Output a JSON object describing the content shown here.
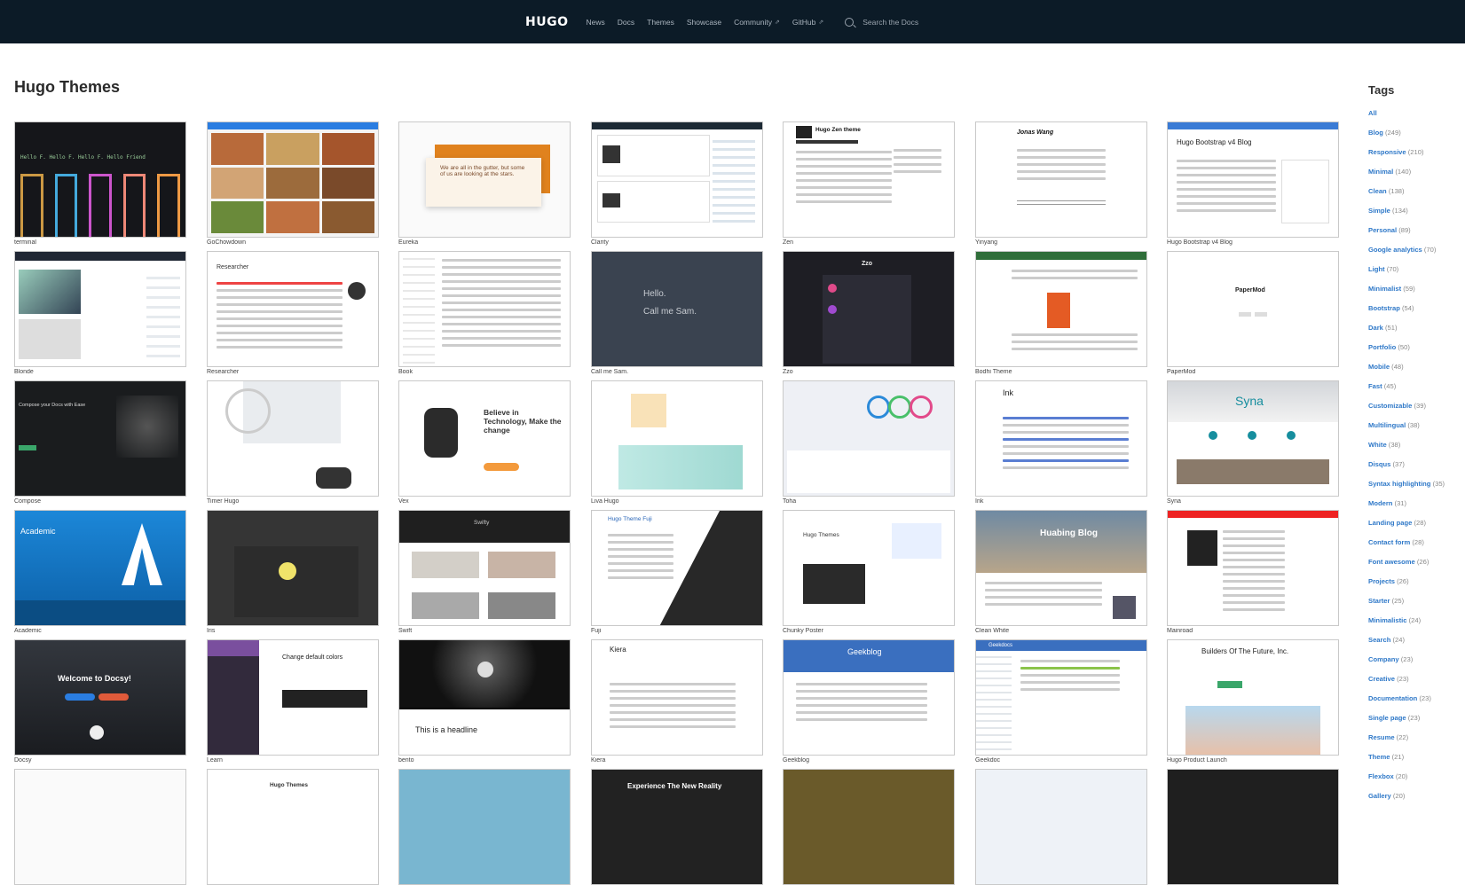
{
  "nav": {
    "logo": "HUGO",
    "links": [
      "News",
      "Docs",
      "Themes",
      "Showcase",
      "Community",
      "GitHub"
    ],
    "search_placeholder": "Search the Docs"
  },
  "page_title": "Hugo Themes",
  "themes": [
    "terminal",
    "GoChowdown",
    "Eureka",
    "Clarity",
    "Zen",
    "Yinyang",
    "Hugo Bootstrap v4 Blog",
    "Blonde",
    "Researcher",
    "Book",
    "Call me Sam.",
    "Zzo",
    "Bodhi Theme",
    "PaperMod",
    "Compose",
    "Timer Hugo",
    "Vex",
    "Liva Hugo",
    "Toha",
    "Ink",
    "Syna",
    "Academic",
    "Iris",
    "Swift",
    "Fuji",
    "Chunky Poster",
    "Clean White",
    "Mainroad",
    "Docsy",
    "Learn",
    "bento",
    "Kiera",
    "Geekblog",
    "Geekdoc",
    "Hugo Product Launch",
    "",
    "",
    "",
    "",
    "",
    "",
    ""
  ],
  "thumb_text": {
    "eureka": "We are all in the gutter, but some of us are looking at the stars.",
    "callme_1": "Hello.",
    "callme_2": "Call me Sam.",
    "bootstrap": "Hugo Bootstrap v4 Blog",
    "zen": "Hugo Zen theme",
    "yinyang": "Jonas Wang",
    "researcher": "Researcher",
    "vex": "Believe in Technology, Make the change",
    "ink": "Ink",
    "syna": "Syna",
    "academic": "Academic",
    "swift": "Swifty",
    "fuji": "Hugo Theme Fuji",
    "chunky": "Hugo Themes",
    "cleanwhite": "Huabing Blog",
    "docsy": "Welcome to Docsy!",
    "learn": "Change default colors",
    "bento": "This is a headline",
    "kiera": "Kiera",
    "geekblog": "Geekblog",
    "geekdoc": "Geekdocs",
    "launch": "Builders Of The Future, Inc.",
    "papermod": "PaperMod",
    "zzo": "Zzo",
    "compose": "Compose your Docs with Ease",
    "reality": "Experience The New Reality",
    "rowsix_chunky": "Hugo Themes"
  },
  "tags_title": "Tags",
  "tags": [
    {
      "name": "All",
      "count": ""
    },
    {
      "name": "Blog",
      "count": "(249)"
    },
    {
      "name": "Responsive",
      "count": "(210)"
    },
    {
      "name": "Minimal",
      "count": "(140)"
    },
    {
      "name": "Clean",
      "count": "(138)"
    },
    {
      "name": "Simple",
      "count": "(134)"
    },
    {
      "name": "Personal",
      "count": "(89)"
    },
    {
      "name": "Google analytics",
      "count": "(70)"
    },
    {
      "name": "Light",
      "count": "(70)"
    },
    {
      "name": "Minimalist",
      "count": "(59)"
    },
    {
      "name": "Bootstrap",
      "count": "(54)"
    },
    {
      "name": "Dark",
      "count": "(51)"
    },
    {
      "name": "Portfolio",
      "count": "(50)"
    },
    {
      "name": "Mobile",
      "count": "(48)"
    },
    {
      "name": "Fast",
      "count": "(45)"
    },
    {
      "name": "Customizable",
      "count": "(39)"
    },
    {
      "name": "Multilingual",
      "count": "(38)"
    },
    {
      "name": "White",
      "count": "(38)"
    },
    {
      "name": "Disqus",
      "count": "(37)"
    },
    {
      "name": "Syntax highlighting",
      "count": "(35)"
    },
    {
      "name": "Modern",
      "count": "(31)"
    },
    {
      "name": "Landing page",
      "count": "(28)"
    },
    {
      "name": "Contact form",
      "count": "(28)"
    },
    {
      "name": "Font awesome",
      "count": "(26)"
    },
    {
      "name": "Projects",
      "count": "(26)"
    },
    {
      "name": "Starter",
      "count": "(25)"
    },
    {
      "name": "Minimalistic",
      "count": "(24)"
    },
    {
      "name": "Search",
      "count": "(24)"
    },
    {
      "name": "Company",
      "count": "(23)"
    },
    {
      "name": "Creative",
      "count": "(23)"
    },
    {
      "name": "Documentation",
      "count": "(23)"
    },
    {
      "name": "Single page",
      "count": "(23)"
    },
    {
      "name": "Resume",
      "count": "(22)"
    },
    {
      "name": "Theme",
      "count": "(21)"
    },
    {
      "name": "Flexbox",
      "count": "(20)"
    },
    {
      "name": "Gallery",
      "count": "(20)"
    }
  ],
  "colors": {
    "topbar": "#0c1b27",
    "tag_link": "#2e78c8"
  }
}
